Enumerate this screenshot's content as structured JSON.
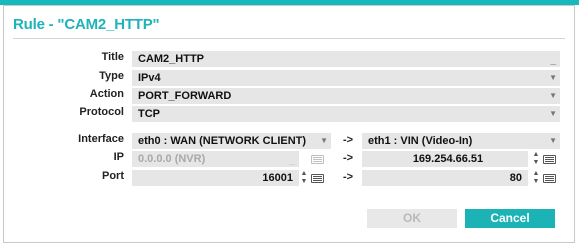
{
  "dialog": {
    "title": "Rule - \"CAM2_HTTP\""
  },
  "labels": {
    "title": "Title",
    "type": "Type",
    "action": "Action",
    "protocol": "Protocol",
    "interface": "Interface",
    "ip": "IP",
    "port": "Port"
  },
  "fields": {
    "title_value": "CAM2_HTTP",
    "type_value": "IPv4",
    "action_value": "PORT_FORWARD",
    "protocol_value": "TCP",
    "interface_left": "eth0 : WAN (NETWORK CLIENT)",
    "interface_right": "eth1 : VIN (Video-In)",
    "ip_left": "0.0.0.0 (NVR)",
    "ip_right": "169.254.66.51",
    "port_left": "16001",
    "port_right": "80"
  },
  "arrows": {
    "symbol": "->"
  },
  "buttons": {
    "ok": "OK",
    "cancel": "Cancel"
  },
  "colors": {
    "accent": "#1db3b8",
    "field_bg": "#e6e6e6"
  }
}
